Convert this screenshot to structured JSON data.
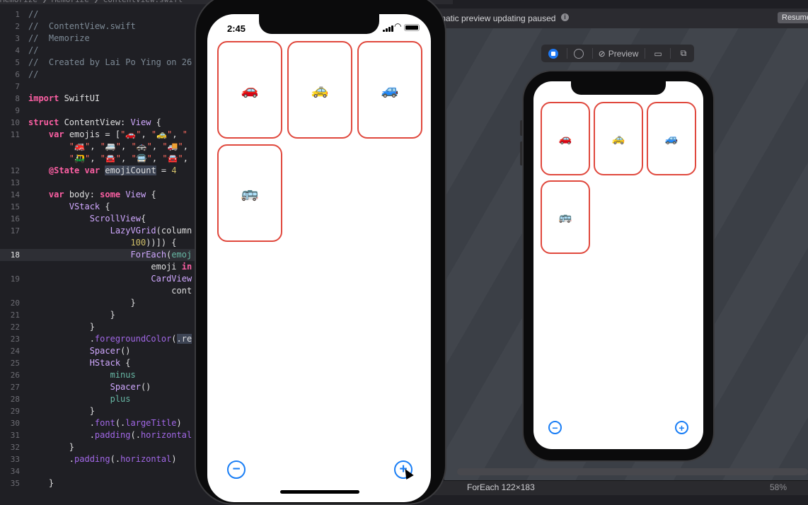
{
  "editor": {
    "breadcrumb": "Memorize ❯ Memorize ❯ ContentView.swift",
    "lines": [
      {
        "n": "1",
        "html": "<span class='c-com'>//</span>"
      },
      {
        "n": "2",
        "html": "<span class='c-com'>//  ContentView.swift</span>"
      },
      {
        "n": "3",
        "html": "<span class='c-com'>//  Memorize</span>"
      },
      {
        "n": "4",
        "html": "<span class='c-com'>//</span>"
      },
      {
        "n": "5",
        "html": "<span class='c-com'>//  Created by Lai Po Ying on 26</span>"
      },
      {
        "n": "6",
        "html": "<span class='c-com'>//</span>"
      },
      {
        "n": "7",
        "html": ""
      },
      {
        "n": "8",
        "html": "<span class='c-kw'>import</span> SwiftUI"
      },
      {
        "n": "9",
        "html": ""
      },
      {
        "n": "10",
        "html": "<span class='c-kw'>struct</span> ContentView: <span class='c-ty'>View</span> {"
      },
      {
        "n": "11",
        "html": "    <span class='c-kw'>var</span> emojis = [<span class='c-str'>\"🚗\"</span>, <span class='c-str'>\"🚕\"</span>, <span class='c-str'>\"</span>"
      },
      {
        "n": "",
        "html": "        <span class='c-str'>\"🚒\"</span>, <span class='c-str'>\"🚐\"</span>, <span class='c-str'>\"🚓\"</span>, <span class='c-str'>\"🚚\"</span>,"
      },
      {
        "n": "",
        "html": "        <span class='c-str'>\"🛺\"</span>, <span class='c-str'>\"🚘\"</span>, <span class='c-str'>\"🚍\"</span>, <span class='c-str'>\"🚘\"</span>,"
      },
      {
        "n": "12",
        "html": "    <span class='c-kw'>@State</span> <span class='c-kw'>var</span> <span class='c-sel'>emojiCount</span> = <span class='c-num'>4</span>"
      },
      {
        "n": "13",
        "html": ""
      },
      {
        "n": "14",
        "html": "    <span class='c-kw'>var</span> body: <span class='c-kw'>some</span> <span class='c-ty'>View</span> {"
      },
      {
        "n": "15",
        "html": "        <span class='c-ty'>VStack</span> {"
      },
      {
        "n": "16",
        "html": "            <span class='c-ty'>ScrollView</span>{"
      },
      {
        "n": "17",
        "html": "                <span class='c-ty'>LazyVGrid</span>(column"
      },
      {
        "n": "",
        "html": "                    <span class='c-num'>100</span>))]) {"
      },
      {
        "n": "18",
        "html": "                    <span class='c-ty'>ForEach</span>(<span class='c-fn'>emoj</span>"
      },
      {
        "n": "",
        "html": "                        emoji <span class='c-kw'>in</span>"
      },
      {
        "n": "19",
        "html": "                        <span class='c-ty'>CardView</span>"
      },
      {
        "n": "",
        "html": "                            cont"
      },
      {
        "n": "20",
        "html": "                    }"
      },
      {
        "n": "21",
        "html": "                }"
      },
      {
        "n": "22",
        "html": "            }"
      },
      {
        "n": "23",
        "html": "            .<span class='c-prop'>foregroundColor</span>(<span class='c-sel'>.re</span>"
      },
      {
        "n": "24",
        "html": "            <span class='c-ty'>Spacer</span>()"
      },
      {
        "n": "25",
        "html": "            <span class='c-ty'>HStack</span> {"
      },
      {
        "n": "26",
        "html": "                <span class='c-fn'>minus</span>"
      },
      {
        "n": "27",
        "html": "                <span class='c-ty'>Spacer</span>()"
      },
      {
        "n": "28",
        "html": "                <span class='c-fn'>plus</span>"
      },
      {
        "n": "29",
        "html": "            }"
      },
      {
        "n": "30",
        "html": "            .<span class='c-prop'>font</span>(.<span class='c-prop'>largeTitle</span>)"
      },
      {
        "n": "31",
        "html": "            .<span class='c-prop'>padding</span>(.<span class='c-prop'>horizontal</span>"
      },
      {
        "n": "32",
        "html": "        }"
      },
      {
        "n": "33",
        "html": "        .<span class='c-prop'>padding</span>(.<span class='c-prop'>horizontal</span>)"
      },
      {
        "n": "34",
        "html": ""
      },
      {
        "n": "35",
        "html": "    }"
      }
    ],
    "current_line": "18"
  },
  "preview_topbar": {
    "message": "matic preview updating paused",
    "info_icon": "ⓘ",
    "resume_label": "Resume"
  },
  "preview_toolbar": {
    "preview_label": "Preview"
  },
  "statusbar": {
    "selection_label": "ForEach  122×183",
    "zoom_label": "58%"
  },
  "simulator": {
    "time": "2:45",
    "cards": [
      "🚗",
      "🚕",
      "🚙",
      "🚌"
    ],
    "minus_icon": "−",
    "plus_icon": "+"
  },
  "colors": {
    "card_border": "#e0483d",
    "control_blue": "#1a7ef5"
  }
}
